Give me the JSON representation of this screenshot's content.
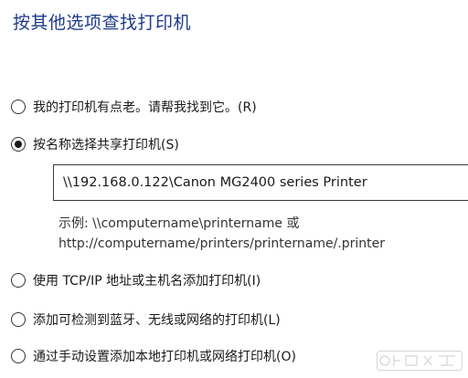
{
  "heading": "按其他选项查找打印机",
  "options": [
    {
      "label": "我的打印机有点老。请帮我找到它。(R)",
      "checked": false
    },
    {
      "label": "按名称选择共享打印机(S)",
      "checked": true
    },
    {
      "label": "使用 TCP/IP 地址或主机名添加打印机(I)",
      "checked": false
    },
    {
      "label": "添加可检测到蓝牙、无线或网络的打印机(L)",
      "checked": false
    },
    {
      "label": "通过手动设置添加本地打印机或网络打印机(O)",
      "checked": false
    }
  ],
  "share_input": {
    "value": "\\\\192.168.0.122\\Canon MG2400 series Printer"
  },
  "example": {
    "line1": "示例: \\\\computername\\printername 或",
    "line2": "http://computername/printers/printername/.printer"
  },
  "watermark": {
    "text": "Baidu 经验"
  }
}
